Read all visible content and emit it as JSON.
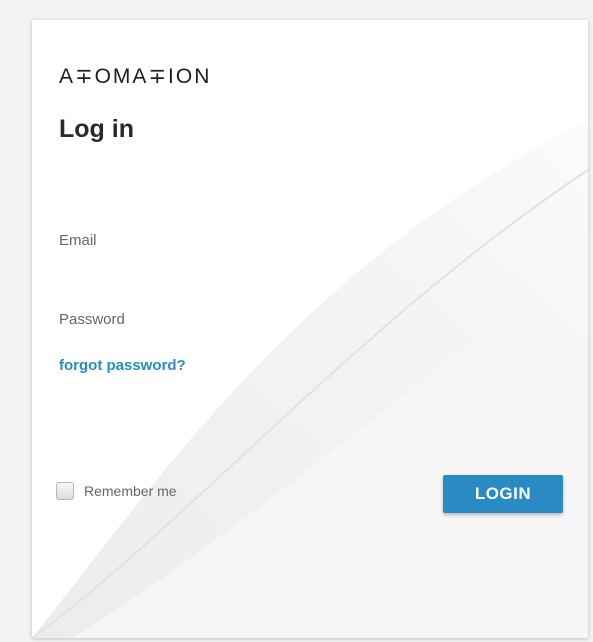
{
  "brand": {
    "logo_text": "A∓OMA∓ION"
  },
  "form": {
    "title": "Log in",
    "email_label": "Email",
    "password_label": "Password",
    "forgot_link": "forgot password?",
    "remember_label": "Remember me",
    "remember_checked": false,
    "login_button": "LOGIN"
  },
  "colors": {
    "accent": "#2a8bc4",
    "label_text": "#666666",
    "title_text": "#2a2a2a",
    "background": "#f3f3f3",
    "card": "#ffffff"
  }
}
